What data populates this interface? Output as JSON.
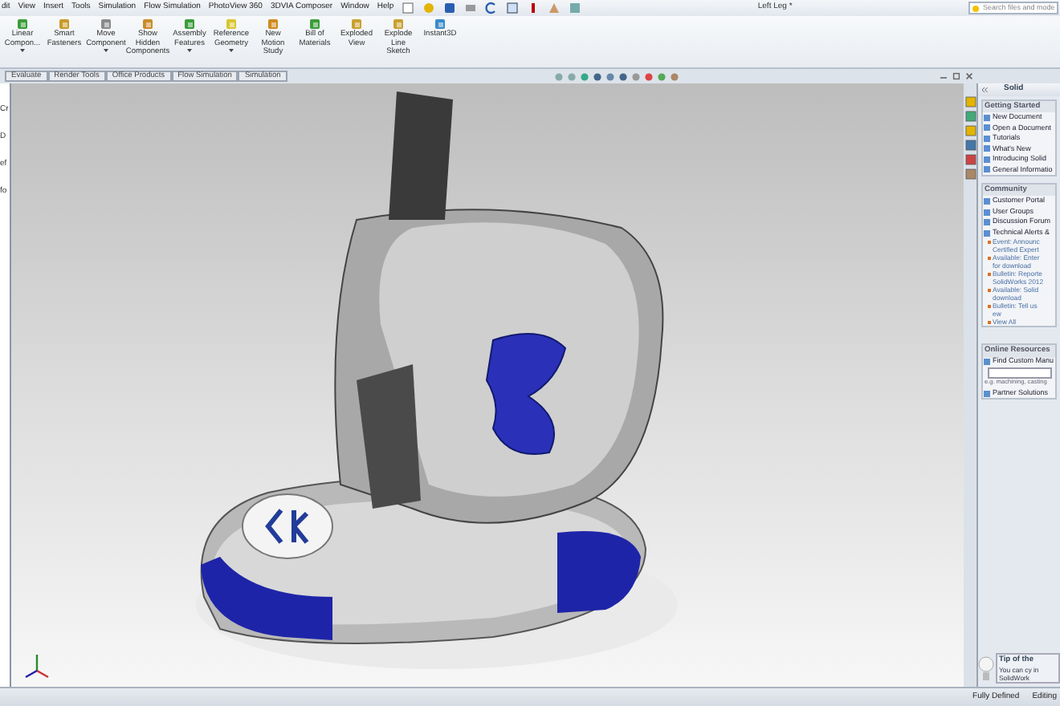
{
  "menu_bar": {
    "items": [
      "dit",
      "View",
      "Insert",
      "Tools",
      "Simulation",
      "Flow Simulation",
      "PhotoView 360",
      "3DVIA Composer",
      "Window",
      "Help"
    ]
  },
  "window": {
    "title": "Left Leg *"
  },
  "search": {
    "placeholder": "Search files and mode"
  },
  "ribbon": {
    "buttons": [
      {
        "label": [
          "Linear",
          "Compon..."
        ],
        "has_menu": true
      },
      {
        "label": [
          "Smart",
          "Fasteners"
        ],
        "has_menu": false
      },
      {
        "label": [
          "Move",
          "Component"
        ],
        "has_menu": true
      },
      {
        "label": [
          "Show",
          "Hidden",
          "Components"
        ],
        "has_menu": false
      },
      {
        "label": [
          "Assembly",
          "Features"
        ],
        "has_menu": true
      },
      {
        "label": [
          "Reference",
          "Geometry"
        ],
        "has_menu": true
      },
      {
        "label": [
          "New",
          "Motion",
          "Study"
        ],
        "has_menu": false
      },
      {
        "label": [
          "Bill of",
          "Materials"
        ],
        "has_menu": false
      },
      {
        "label": [
          "Exploded",
          "View"
        ],
        "has_menu": false
      },
      {
        "label": [
          "Explode",
          "Line",
          "Sketch"
        ],
        "has_menu": false
      },
      {
        "label": [
          "Instant3D"
        ],
        "has_menu": false
      }
    ]
  },
  "command_tabs": [
    "Evaluate",
    "Render Tools",
    "Office Products",
    "Flow Simulation",
    "Simulation"
  ],
  "feature_tree": {
    "fragments": [
      "Cr",
      "D",
      "ef",
      "fo"
    ]
  },
  "task_pane": {
    "title": "Solid",
    "sections": [
      {
        "title": "Getting Started",
        "items": [
          {
            "label": "New Document",
            "kind": "link"
          },
          {
            "label": "Open a Document",
            "kind": "link"
          },
          {
            "label": "Tutorials",
            "kind": "link"
          },
          {
            "label": "What's New",
            "kind": "link"
          },
          {
            "label": "Introducing Solid",
            "kind": "link"
          },
          {
            "label": "General Informatio",
            "kind": "link"
          }
        ]
      },
      {
        "title": "Community",
        "items": [
          {
            "label": "Customer Portal",
            "kind": "link"
          },
          {
            "label": "User Groups",
            "kind": "link"
          },
          {
            "label": "Discussion Forum",
            "kind": "link"
          },
          {
            "label": "Technical Alerts &",
            "kind": "link"
          },
          {
            "label": "Event: Announc",
            "kind": "news"
          },
          {
            "label": "Certified Expert",
            "kind": "news_cont"
          },
          {
            "label": "Available: Enter",
            "kind": "news"
          },
          {
            "label": "for download",
            "kind": "news_cont"
          },
          {
            "label": "Bulletin: Reporte",
            "kind": "news"
          },
          {
            "label": "SolidWorks 2012",
            "kind": "news_cont"
          },
          {
            "label": "Available: Solid",
            "kind": "news"
          },
          {
            "label": "download",
            "kind": "news_cont"
          },
          {
            "label": "Bulletin: Tell us",
            "kind": "news"
          },
          {
            "label": "ew",
            "kind": "news_cont"
          },
          {
            "label": "View All",
            "kind": "news"
          }
        ]
      },
      {
        "title": "Online Resources",
        "items": [
          {
            "label": "Find Custom Manu",
            "kind": "link"
          },
          {
            "kind": "input"
          },
          {
            "label": "e.g. machining, casting",
            "kind": "hint"
          },
          {
            "label": "Partner Solutions",
            "kind": "link"
          }
        ]
      }
    ],
    "tip": {
      "title": "Tip of the",
      "text": "You can cy in SolidWork"
    }
  },
  "status_bar": {
    "items": [
      "Fully Defined",
      "Editing"
    ]
  }
}
